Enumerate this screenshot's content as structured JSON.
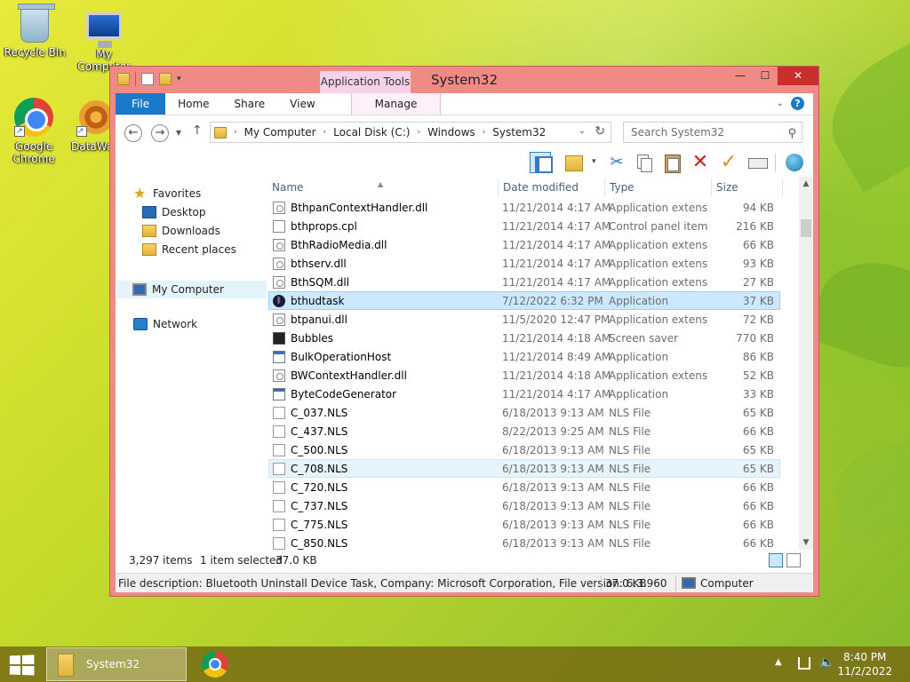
{
  "desktop": {
    "icons": [
      {
        "label": "Recycle Bin"
      },
      {
        "label": "My Computer"
      },
      {
        "label": "Google Chrome"
      },
      {
        "label": "DataWa"
      }
    ]
  },
  "window": {
    "title": "System32",
    "app_tools_label": "Application Tools",
    "controls": {
      "minimize": "—",
      "maximize": "☐",
      "close": "✕"
    },
    "tabs": {
      "file": "File",
      "home": "Home",
      "share": "Share",
      "view": "View",
      "manage": "Manage"
    },
    "help": "?",
    "address": {
      "crumbs": [
        "My Computer",
        "Local Disk (C:)",
        "Windows",
        "System32"
      ]
    },
    "search": {
      "placeholder": "Search System32"
    }
  },
  "nav": {
    "favorites": "Favorites",
    "desktop": "Desktop",
    "downloads": "Downloads",
    "recent": "Recent places",
    "computer": "My Computer",
    "network": "Network"
  },
  "columns": {
    "name": "Name",
    "date": "Date modified",
    "type": "Type",
    "size": "Size"
  },
  "files": [
    {
      "name": "BthpanContextHandler.dll",
      "date": "11/21/2014 4:17 AM",
      "type": "Application extens...",
      "size": "94 KB",
      "icon": "dll"
    },
    {
      "name": "bthprops.cpl",
      "date": "11/21/2014 4:17 AM",
      "type": "Control panel item",
      "size": "216 KB",
      "icon": "cpl"
    },
    {
      "name": "BthRadioMedia.dll",
      "date": "11/21/2014 4:17 AM",
      "type": "Application extens...",
      "size": "66 KB",
      "icon": "dll"
    },
    {
      "name": "bthserv.dll",
      "date": "11/21/2014 4:17 AM",
      "type": "Application extens...",
      "size": "93 KB",
      "icon": "dll"
    },
    {
      "name": "BthSQM.dll",
      "date": "11/21/2014 4:17 AM",
      "type": "Application extens...",
      "size": "27 KB",
      "icon": "dll"
    },
    {
      "name": "bthudtask",
      "date": "7/12/2022 6:32 PM",
      "type": "Application",
      "size": "37 KB",
      "icon": "bt"
    },
    {
      "name": "btpanui.dll",
      "date": "11/5/2020 12:47 PM",
      "type": "Application extens...",
      "size": "72 KB",
      "icon": "dll"
    },
    {
      "name": "Bubbles",
      "date": "11/21/2014 4:18 AM",
      "type": "Screen saver",
      "size": "770 KB",
      "icon": "scr"
    },
    {
      "name": "BulkOperationHost",
      "date": "11/21/2014 8:49 AM",
      "type": "Application",
      "size": "86 KB",
      "icon": "app"
    },
    {
      "name": "BWContextHandler.dll",
      "date": "11/21/2014 4:18 AM",
      "type": "Application extens...",
      "size": "52 KB",
      "icon": "dll"
    },
    {
      "name": "ByteCodeGenerator",
      "date": "11/21/2014 4:17 AM",
      "type": "Application",
      "size": "33 KB",
      "icon": "app"
    },
    {
      "name": "C_037.NLS",
      "date": "6/18/2013 9:13 AM",
      "type": "NLS File",
      "size": "65 KB",
      "icon": "nls"
    },
    {
      "name": "C_437.NLS",
      "date": "8/22/2013 9:25 AM",
      "type": "NLS File",
      "size": "66 KB",
      "icon": "nls"
    },
    {
      "name": "C_500.NLS",
      "date": "6/18/2013 9:13 AM",
      "type": "NLS File",
      "size": "65 KB",
      "icon": "nls"
    },
    {
      "name": "C_708.NLS",
      "date": "6/18/2013 9:13 AM",
      "type": "NLS File",
      "size": "65 KB",
      "icon": "nls"
    },
    {
      "name": "C_720.NLS",
      "date": "6/18/2013 9:13 AM",
      "type": "NLS File",
      "size": "66 KB",
      "icon": "nls"
    },
    {
      "name": "C_737.NLS",
      "date": "6/18/2013 9:13 AM",
      "type": "NLS File",
      "size": "66 KB",
      "icon": "nls"
    },
    {
      "name": "C_775.NLS",
      "date": "6/18/2013 9:13 AM",
      "type": "NLS File",
      "size": "66 KB",
      "icon": "nls"
    },
    {
      "name": "C_850.NLS",
      "date": "6/18/2013 9:13 AM",
      "type": "NLS File",
      "size": "66 KB",
      "icon": "nls"
    }
  ],
  "selected_index": 5,
  "hover_index": 14,
  "status": {
    "items": "3,297 items",
    "selected": "1 item selected",
    "size": "37.0 KB"
  },
  "details": {
    "description": "File description: Bluetooth Uninstall Device Task, Company: Microsoft Corporation, File version: 6.3.960",
    "size": "37.0 KB",
    "location": "Computer"
  },
  "taskbar": {
    "task_label": "System32",
    "time": "8:40 PM",
    "date": "11/2/2022"
  },
  "colors": {
    "window_frame": "#f08a84",
    "accent": "#1979ca",
    "selection": "#cce8ff"
  }
}
